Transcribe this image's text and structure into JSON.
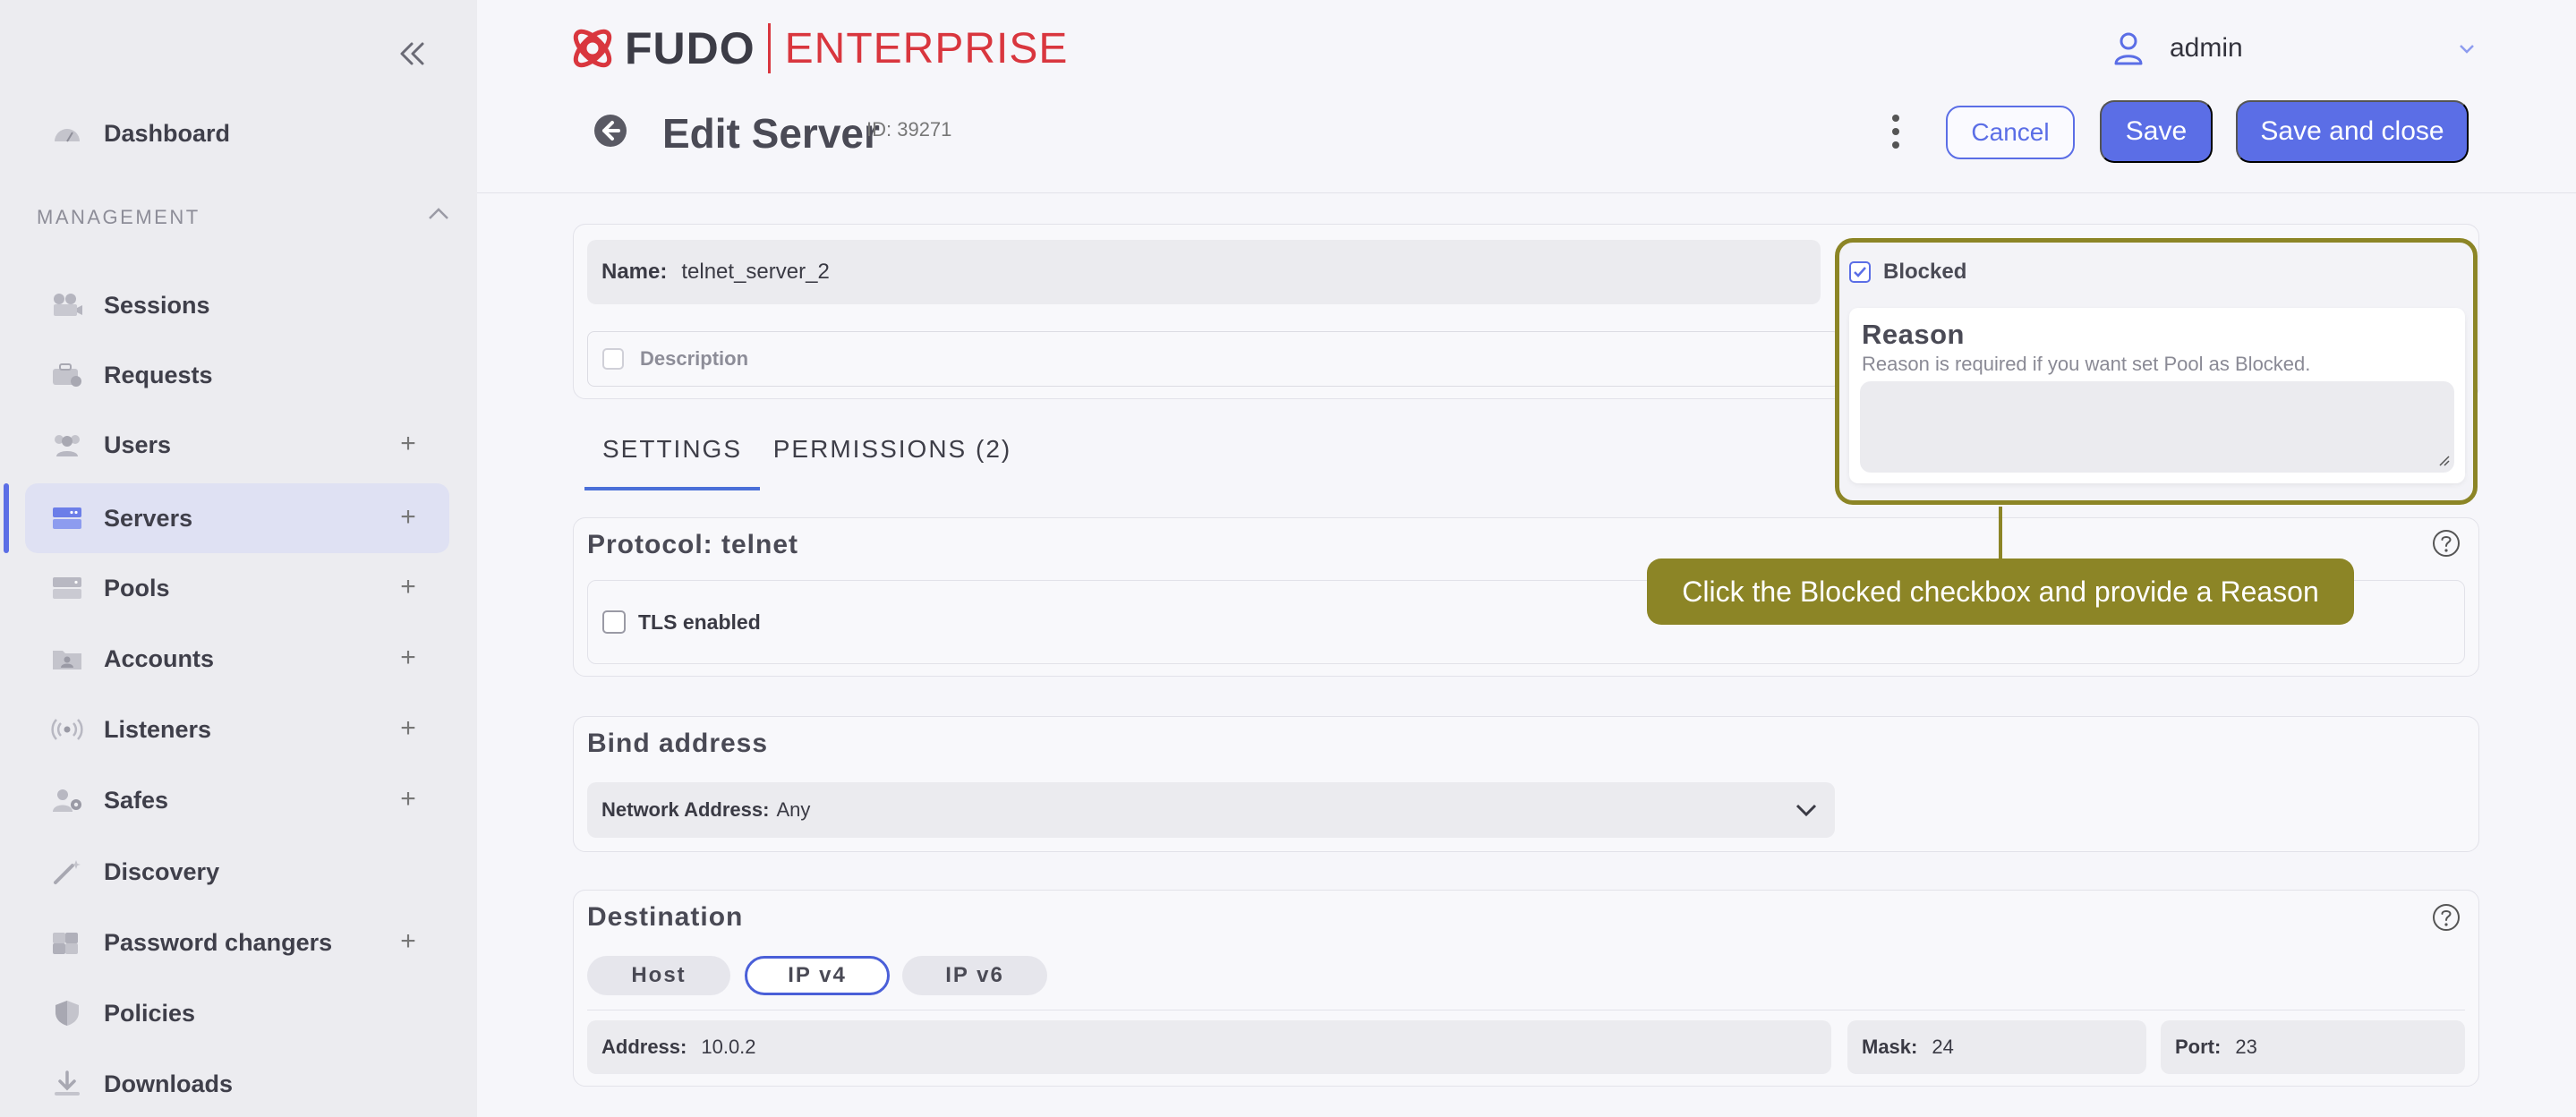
{
  "sidebar": {
    "dashboard": "Dashboard",
    "section_label": "MANAGEMENT",
    "items": [
      {
        "label": "Sessions",
        "icon": "camera-icon"
      },
      {
        "label": "Requests",
        "icon": "briefcase-icon"
      },
      {
        "label": "Users",
        "icon": "users-icon"
      },
      {
        "label": "Servers",
        "icon": "server-icon"
      },
      {
        "label": "Pools",
        "icon": "pool-icon"
      },
      {
        "label": "Accounts",
        "icon": "account-folder-icon"
      },
      {
        "label": "Listeners",
        "icon": "broadcast-icon"
      },
      {
        "label": "Safes",
        "icon": "safe-user-icon"
      },
      {
        "label": "Discovery",
        "icon": "magic-wand-icon"
      },
      {
        "label": "Password changers",
        "icon": "puzzle-icon"
      },
      {
        "label": "Policies",
        "icon": "shield-icon"
      },
      {
        "label": "Downloads",
        "icon": "download-icon"
      }
    ],
    "plus": "+"
  },
  "header": {
    "logo_main": "FUDO",
    "logo_sub": "ENTERPRISE",
    "user": "admin",
    "title": "Edit Server",
    "id_text": "ID: 39271",
    "cancel": "Cancel",
    "save": "Save",
    "save_close": "Save and close"
  },
  "server": {
    "name_label": "Name:",
    "name_value": "telnet_server_2",
    "description_label": "Description"
  },
  "blocked": {
    "label": "Blocked",
    "reason_title": "Reason",
    "reason_help": "Reason is required if you want set Pool as Blocked."
  },
  "tabs": {
    "settings": "SETTINGS",
    "permissions": "PERMISSIONS (2)"
  },
  "protocol": {
    "title": "Protocol: telnet",
    "tls_label": "TLS enabled"
  },
  "bind": {
    "title": "Bind address",
    "network_label": "Network Address:",
    "network_value": "Any"
  },
  "destination": {
    "title": "Destination",
    "pills": [
      "Host",
      "IP v4",
      "IP v6"
    ],
    "address_label": "Address:",
    "address_value": "10.0.2",
    "mask_label": "Mask:",
    "mask_value": "24",
    "port_label": "Port:",
    "port_value": "23"
  },
  "tooltip": "Click the Blocked checkbox and provide a Reason",
  "colors": {
    "accent": "#5b6ee6",
    "brand_red": "#d9363e",
    "callout": "#8c8526"
  }
}
